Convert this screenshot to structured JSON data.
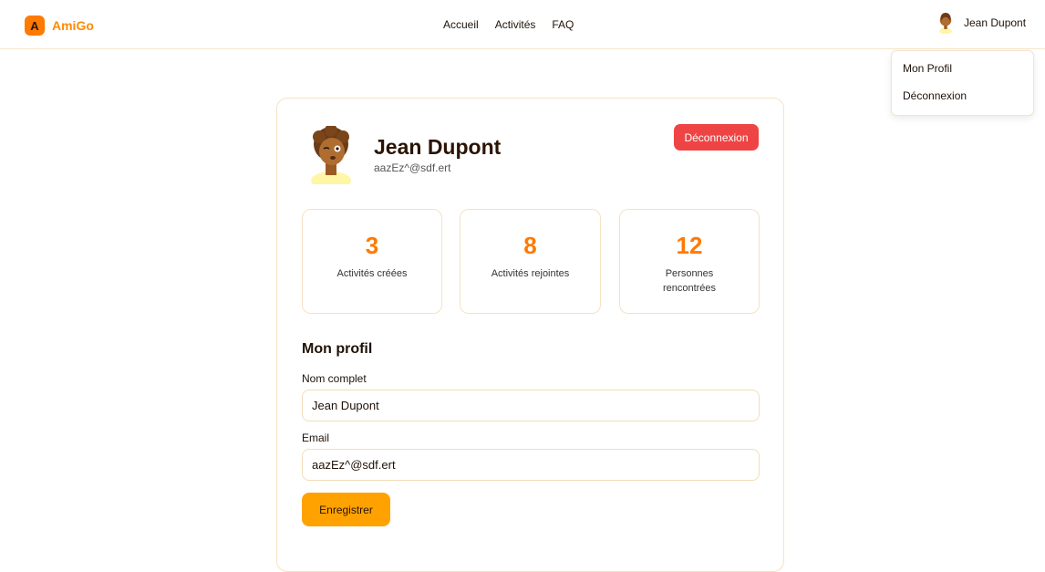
{
  "brand": {
    "logo_letter": "A",
    "name": "AmiGo"
  },
  "nav": {
    "links": [
      "Accueil",
      "Activités",
      "FAQ"
    ]
  },
  "user_menu": {
    "name": "Jean Dupont"
  },
  "dropdown": {
    "items": [
      "Mon Profil",
      "Déconnexion"
    ]
  },
  "profile": {
    "name": "Jean Dupont",
    "email": "aazEz^@sdf.ert",
    "logout_label": "Déconnexion"
  },
  "stats": [
    {
      "value": "3",
      "label": "Activités créées"
    },
    {
      "value": "8",
      "label": "Activités rejointes"
    },
    {
      "value": "12",
      "label": "Personnes rencontrées"
    }
  ],
  "form": {
    "title": "Mon profil",
    "name_label": "Nom complet",
    "name_value": "Jean Dupont",
    "email_label": "Email",
    "email_value": "aazEz^@sdf.ert",
    "save_label": "Enregistrer"
  },
  "colors": {
    "accent": "#ff7a00",
    "save_button": "#ffa200",
    "logout_button": "#ef4444",
    "border": "#f6e2c4"
  },
  "icons": {
    "avatar": "avatar-icon"
  }
}
